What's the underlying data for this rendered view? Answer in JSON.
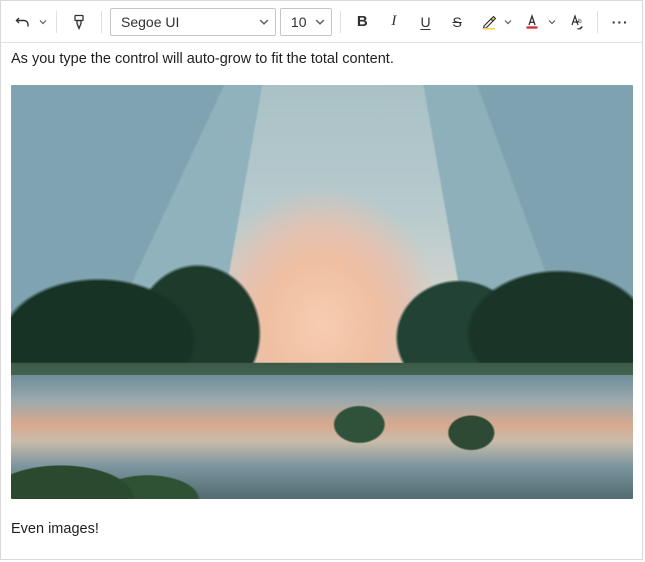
{
  "toolbar": {
    "undo_icon": "undo",
    "format_painter_icon": "format-painter",
    "font_name": "Segoe UI",
    "font_size": "10",
    "bold": "B",
    "italic": "I",
    "underline": "U",
    "strike": "S",
    "highlight_icon": "highlighter",
    "font_color_icon": "font-color",
    "clear_format_icon": "clear-formatting",
    "more": "···"
  },
  "content": {
    "line1": "As you type the control will auto-grow to fit the total content.",
    "image_alt": "Landscape photo: valley with river, pine trees, hazy blue mountains and an orange sunset glow.",
    "line2": "Even images!"
  }
}
